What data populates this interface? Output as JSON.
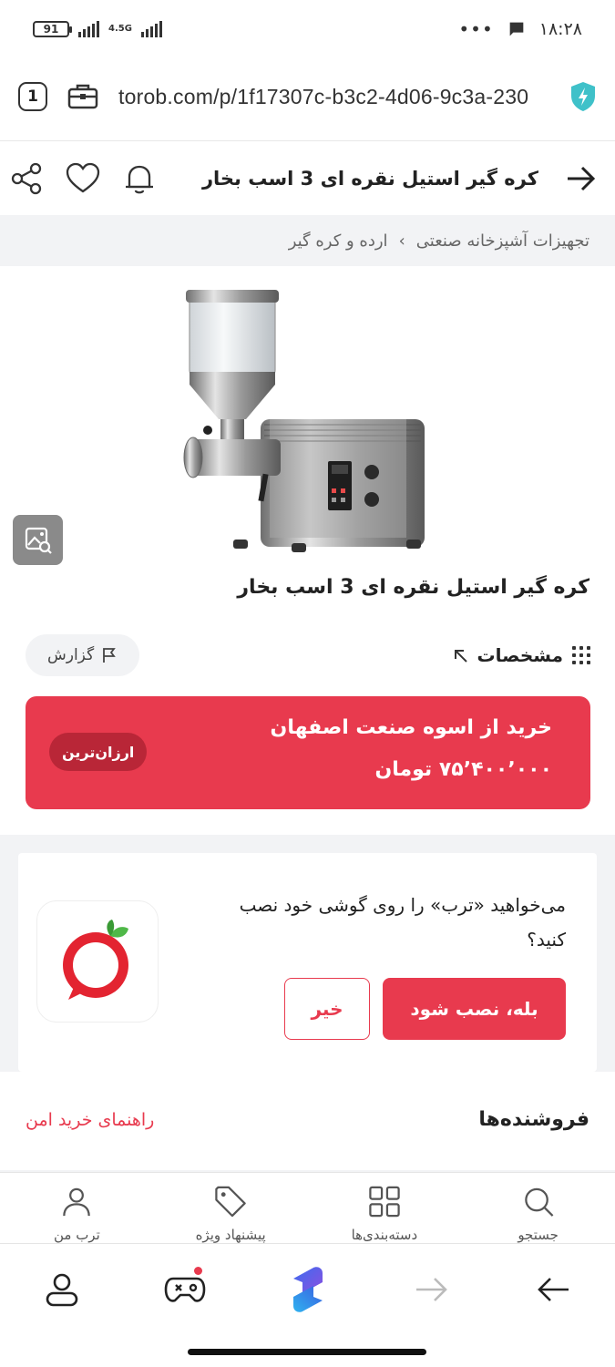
{
  "status_bar": {
    "battery": "91",
    "network": "4.5G",
    "time": "۱۸:۲۸"
  },
  "url_bar": {
    "tab_count": "1",
    "url": "torob.com/p/1f17307c-b3c2-4d06-9c3a-230"
  },
  "header": {
    "title": "کره گیر استیل نقره ای 3 اسب بخار"
  },
  "breadcrumb": {
    "items": [
      "تجهیزات آشپزخانه صنعتی",
      "›",
      "ارده و کره گیر"
    ]
  },
  "product": {
    "title": "کره گیر استیل نقره ای 3 اسب بخار",
    "specs_label": "مشخصات",
    "report_label": "گزارش"
  },
  "buy_card": {
    "title": "خرید از اسوه صنعت اصفهان",
    "price": "۷۵٬۴۰۰٬۰۰۰ تومان",
    "badge": "ارزان‌ترین"
  },
  "install_prompt": {
    "text": "می‌خواهید «ترب» را روی گوشی خود نصب کنید؟",
    "yes_label": "بله، نصب شود",
    "no_label": "خیر"
  },
  "sellers": {
    "title": "فروشنده‌ها",
    "safe_guide": "راهنمای خرید امن"
  },
  "site_nav": {
    "items": [
      {
        "label": "ترب من",
        "icon": "user-icon"
      },
      {
        "label": "پیشنهاد ویژه",
        "icon": "tag-icon"
      },
      {
        "label": "دسته‌بندی‌ها",
        "icon": "grid-icon"
      },
      {
        "label": "جستجو",
        "icon": "search-icon"
      }
    ]
  },
  "colors": {
    "accent": "#e83a4e",
    "accent_dark": "#b92637",
    "gray_bg": "#f2f3f5"
  }
}
